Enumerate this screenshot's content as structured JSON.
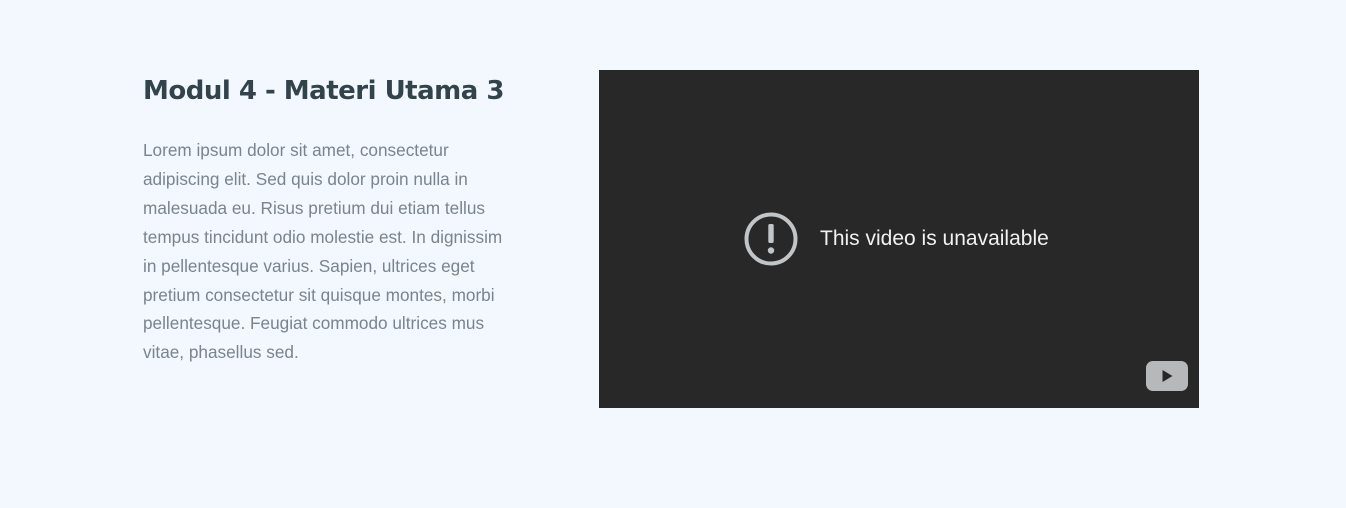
{
  "module": {
    "title": "Modul 4 - Materi Utama 3",
    "description": "Lorem ipsum dolor sit amet, consectetur adipiscing elit. Sed quis dolor proin nulla in malesuada eu. Risus pretium dui etiam tellus tempus tincidunt odio molestie est. In dignissim in pellentesque varius. Sapien, ultrices eget pretium consectetur sit quisque montes, morbi pellentesque. Feugiat commodo ultrices mus vitae, phasellus sed."
  },
  "video": {
    "message": "This video is unavailable",
    "message_icon": "exclamation-circle-icon",
    "logo_icon": "youtube-logo-icon"
  },
  "colors": {
    "page_background": "#f3f8fe",
    "title": "#33434c",
    "body_text": "#7a848b",
    "video_background": "#282828",
    "video_text": "#f1f1f1",
    "video_icon": "#c1c5c8"
  }
}
